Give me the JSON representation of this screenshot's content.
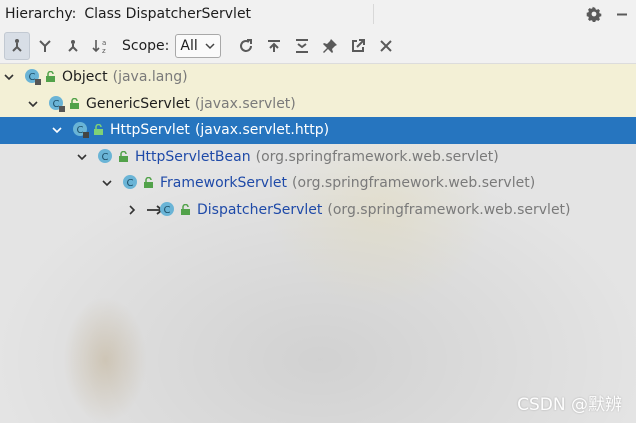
{
  "window": {
    "title_label": "Hierarchy:",
    "title_value": "Class DispatcherServlet",
    "icons": [
      "gear-icon",
      "minimize-icon"
    ]
  },
  "toolbar": {
    "buttons": [
      "subtypes-hierarchy-icon",
      "supertypes-hierarchy-icon",
      "class-hierarchy-icon",
      "sort-alphabetically-icon"
    ],
    "scope_label": "Scope:",
    "scope_value": "All",
    "actions": [
      "refresh-icon",
      "open-in-tab-icon",
      "expand-all-icon",
      "pin-icon",
      "export-icon",
      "close-icon"
    ]
  },
  "tree": {
    "rows": [
      {
        "name": "Object",
        "package": "(java.lang)",
        "expanded": true,
        "level": 0
      },
      {
        "name": "GenericServlet",
        "package": "(javax.servlet)",
        "expanded": true,
        "level": 1
      },
      {
        "name": "HttpServlet",
        "package": "(javax.servlet.http)",
        "expanded": true,
        "level": 2,
        "selected": true
      },
      {
        "name": "HttpServletBean",
        "package": "(org.springframework.web.servlet)",
        "expanded": true,
        "level": 3
      },
      {
        "name": "FrameworkServlet",
        "package": "(org.springframework.web.servlet)",
        "expanded": true,
        "level": 4
      },
      {
        "name": "DispatcherServlet",
        "package": "(org.springframework.web.servlet)",
        "expanded": false,
        "level": 5,
        "current": true
      }
    ]
  },
  "watermark": "CSDN @默辨",
  "colors": {
    "selection": "#2675bf",
    "class_name_blue": "#1f4aa8",
    "package_gray": "#7a7a7a",
    "class_icon": "#6ab4d6",
    "lock_icon": "#52a24a"
  }
}
